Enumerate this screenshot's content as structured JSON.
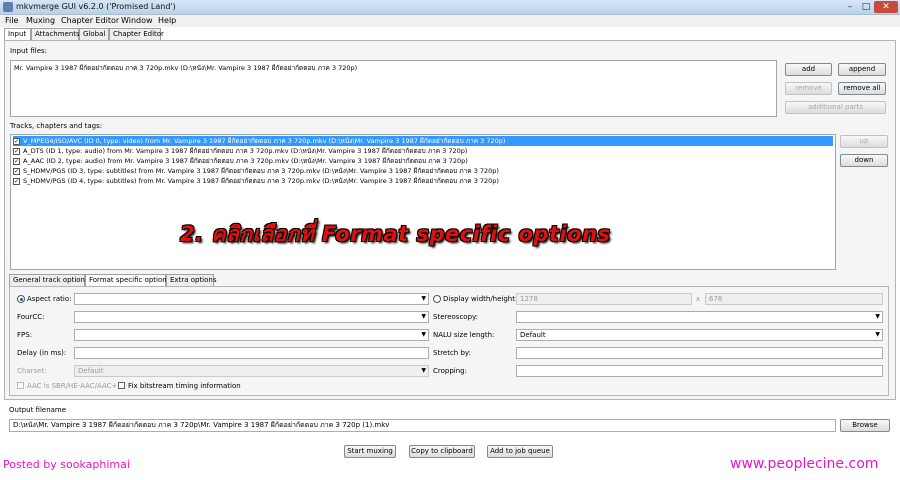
{
  "window": {
    "title": "mkvmerge GUI v6.2.0 ('Promised Land')"
  },
  "menu": [
    "File",
    "Muxing",
    "Chapter Editor",
    "Window",
    "Help"
  ],
  "main_tabs": [
    "Input",
    "Attachments",
    "Global",
    "Chapter Editor"
  ],
  "input_files": {
    "label": "Input files:",
    "items": [
      "Mr. Vampire 3 1987 ผีกัดอย่ากัดตอบ ภาค 3 720p.mkv (D:\\หนัง\\Mr. Vampire 3 1987 ผีกัดอย่ากัดตอบ ภาค 3 720p)"
    ],
    "buttons": {
      "add": "add",
      "append": "append",
      "remove": "remove",
      "remove_all": "remove all",
      "additional_parts": "additional parts"
    }
  },
  "tracks": {
    "label": "Tracks, chapters and tags:",
    "items": [
      "V_MPEG4/ISO/AVC (ID 0, type: video) from Mr. Vampire 3 1987 ผีกัดอย่ากัดตอบ ภาค 3 720p.mkv (D:\\หนัง\\Mr. Vampire 3 1987 ผีกัดอย่ากัดตอบ ภาค 3 720p)",
      "A_DTS (ID 1, type: audio) from Mr. Vampire 3 1987 ผีกัดอย่ากัดตอบ ภาค 3 720p.mkv (D:\\หนัง\\Mr. Vampire 3 1987 ผีกัดอย่ากัดตอบ ภาค 3 720p)",
      "A_AAC (ID 2, type: audio) from Mr. Vampire 3 1987 ผีกัดอย่ากัดตอบ ภาค 3 720p.mkv (D:\\หนัง\\Mr. Vampire 3 1987 ผีกัดอย่ากัดตอบ ภาค 3 720p)",
      "S_HDMV/PGS (ID 3, type: subtitles) from Mr. Vampire 3 1987 ผีกัดอย่ากัดตอบ ภาค 3 720p.mkv (D:\\หนัง\\Mr. Vampire 3 1987 ผีกัดอย่ากัดตอบ ภาค 3 720p)",
      "S_HDMV/PGS (ID 4, type: subtitles) from Mr. Vampire 3 1987 ผีกัดอย่ากัดตอบ ภาค 3 720p.mkv (D:\\หนัง\\Mr. Vampire 3 1987 ผีกัดอย่ากัดตอบ ภาค 3 720p)"
    ],
    "buttons": {
      "up": "up",
      "down": "down"
    }
  },
  "annotation": "2. คลิกเลือกที่ Format specific options",
  "sub_tabs": [
    "General track options",
    "Format specific options",
    "Extra options"
  ],
  "format_options": {
    "aspect_ratio_label": "Aspect ratio:",
    "display_wh_label": "Display width/height:",
    "display_width": "1278",
    "display_sep": "x",
    "display_height": "678",
    "fourcc_label": "FourCC:",
    "stereoscopy_label": "Stereoscopy:",
    "fps_label": "FPS:",
    "nalu_label": "NALU size length:",
    "nalu_value": "Default",
    "delay_label": "Delay (in ms):",
    "stretch_label": "Stretch by:",
    "charset_label": "Charset:",
    "charset_value": "Default",
    "cropping_label": "Cropping:",
    "aac_label": "AAC is SBR/HE-AAC/AAC+",
    "fix_label": "Fix bitstream timing information"
  },
  "output": {
    "label": "Output filename",
    "value": "D:\\หนัง\\Mr. Vampire 3 1987 ผีกัดอย่ากัดตอบ ภาค 3 720p\\Mr. Vampire 3 1987 ผีกัดอย่ากัดตอบ ภาค 3 720p (1).mkv",
    "browse": "Browse"
  },
  "actions": {
    "start": "Start muxing",
    "copy": "Copy to clipboard",
    "job": "Add to job queue"
  },
  "watermarks": {
    "left": "Posted by sookaphimai",
    "right": "www.peoplecine.com"
  },
  "colors": {
    "selection": "#3399ff",
    "annotation": "#e01010",
    "watermark": "#e815d0"
  }
}
